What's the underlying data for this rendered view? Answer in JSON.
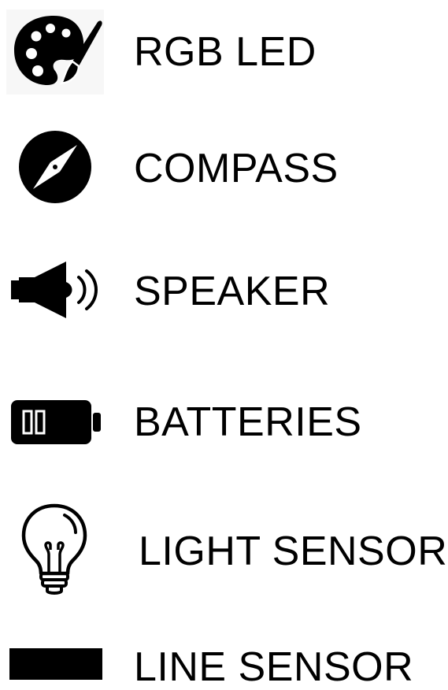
{
  "items": [
    {
      "label": "RGB LED",
      "icon": "palette-icon"
    },
    {
      "label": "COMPASS",
      "icon": "compass-icon"
    },
    {
      "label": "SPEAKER",
      "icon": "speaker-icon"
    },
    {
      "label": "BATTERIES",
      "icon": "battery-icon"
    },
    {
      "label": "LIGHT SENSOR",
      "icon": "lightbulb-icon"
    },
    {
      "label": "LINE SENSOR",
      "icon": "line-sensor-icon"
    }
  ],
  "colors": {
    "foreground": "#000000",
    "background": "#ffffff"
  }
}
